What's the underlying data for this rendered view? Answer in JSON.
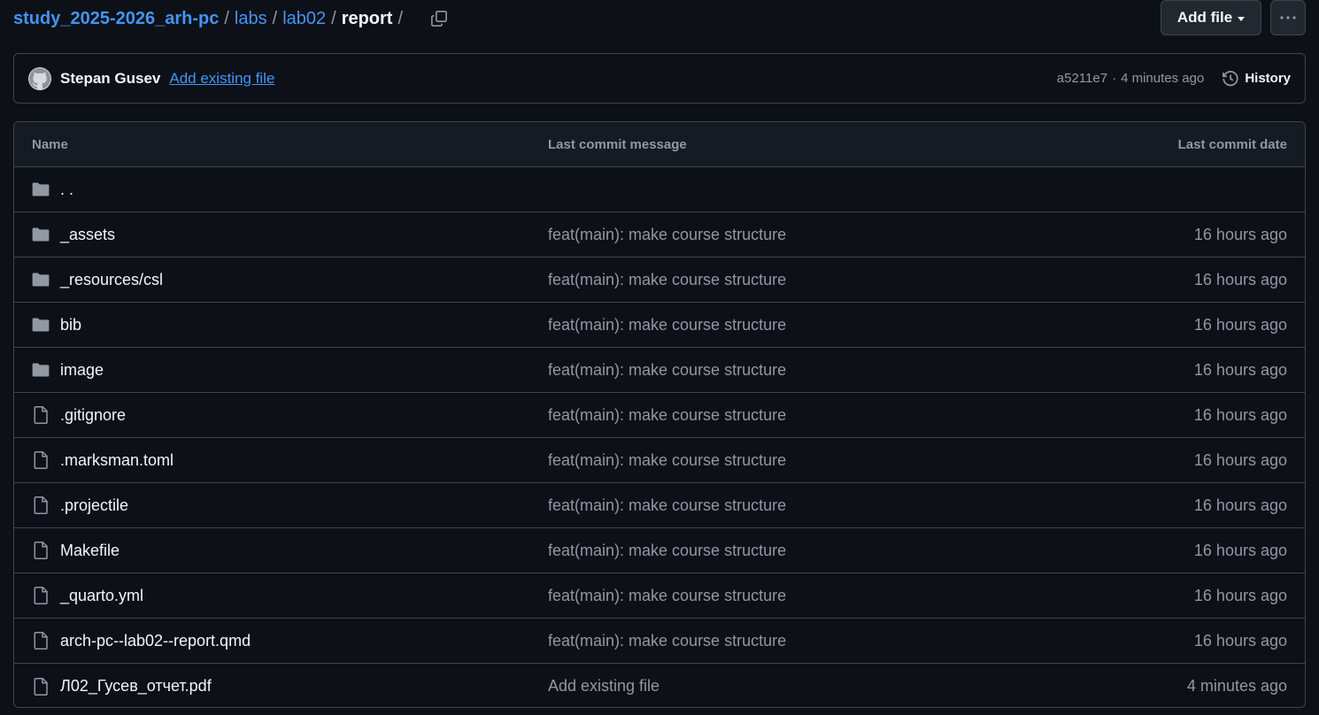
{
  "breadcrumb": {
    "repo": "study_2025-2026_arh-pc",
    "path": [
      "labs",
      "lab02"
    ],
    "current": "report",
    "separator": "/"
  },
  "toolbar": {
    "add_file_label": "Add file",
    "more_label": "···"
  },
  "commit": {
    "author": "Stepan Gusev",
    "message": "Add existing file",
    "sha": "a5211e7",
    "time": "4 minutes ago",
    "dot": "·",
    "history_label": "History"
  },
  "table": {
    "headers": {
      "name": "Name",
      "message": "Last commit message",
      "date": "Last commit date"
    },
    "parent_label": ". .",
    "rows": [
      {
        "type": "folder",
        "name": "_assets",
        "message": "feat(main): make course structure",
        "date": "16 hours ago"
      },
      {
        "type": "folder",
        "name": "_resources/csl",
        "message": "feat(main): make course structure",
        "date": "16 hours ago"
      },
      {
        "type": "folder",
        "name": "bib",
        "message": "feat(main): make course structure",
        "date": "16 hours ago"
      },
      {
        "type": "folder",
        "name": "image",
        "message": "feat(main): make course structure",
        "date": "16 hours ago"
      },
      {
        "type": "file",
        "name": ".gitignore",
        "message": "feat(main): make course structure",
        "date": "16 hours ago"
      },
      {
        "type": "file",
        "name": ".marksman.toml",
        "message": "feat(main): make course structure",
        "date": "16 hours ago"
      },
      {
        "type": "file",
        "name": ".projectile",
        "message": "feat(main): make course structure",
        "date": "16 hours ago"
      },
      {
        "type": "file",
        "name": "Makefile",
        "message": "feat(main): make course structure",
        "date": "16 hours ago"
      },
      {
        "type": "file",
        "name": "_quarto.yml",
        "message": "feat(main): make course structure",
        "date": "16 hours ago"
      },
      {
        "type": "file",
        "name": "arch-pc--lab02--report.qmd",
        "message": "feat(main): make course structure",
        "date": "16 hours ago"
      },
      {
        "type": "file",
        "name": "Л02_Гусев_отчет.pdf",
        "message": "Add existing file",
        "date": "4 minutes ago"
      }
    ]
  },
  "colors": {
    "background": "#0d1117",
    "link": "#4493f8",
    "border": "#3d444d",
    "muted": "#9198a1"
  }
}
